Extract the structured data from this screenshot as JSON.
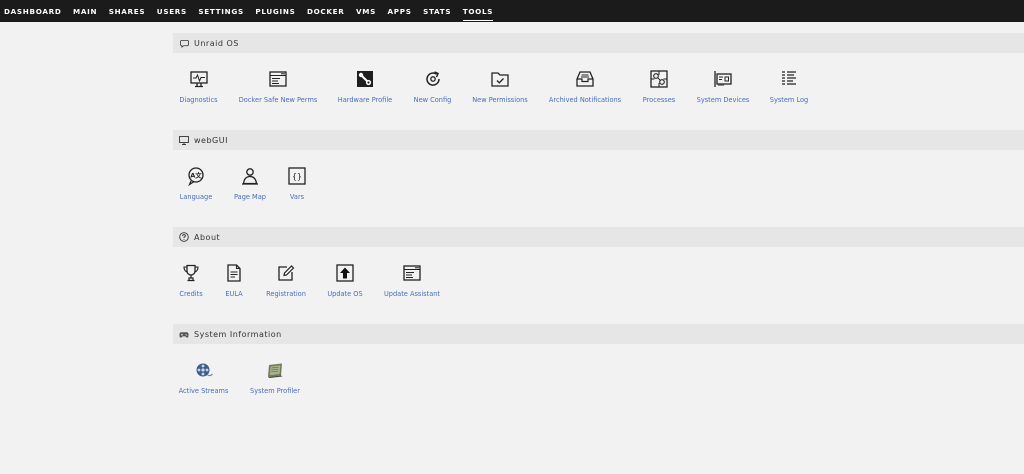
{
  "nav": {
    "items": [
      "DASHBOARD",
      "MAIN",
      "SHARES",
      "USERS",
      "SETTINGS",
      "PLUGINS",
      "DOCKER",
      "VMS",
      "APPS",
      "STATS",
      "TOOLS"
    ],
    "active": "TOOLS"
  },
  "sections": {
    "unraid_os": {
      "title": "Unraid OS",
      "icon": "chat-bubble-icon",
      "tools": [
        "Diagnostics",
        "Docker Safe New Perms",
        "Hardware Profile",
        "New Config",
        "New Permissions",
        "Archived Notifications",
        "Processes",
        "System Devices",
        "System Log"
      ]
    },
    "webgui": {
      "title": "webGUI",
      "icon": "monitor-icon",
      "tools": [
        "Language",
        "Page Map",
        "Vars"
      ]
    },
    "about": {
      "title": "About",
      "icon": "question-circle-icon",
      "tools": [
        "Credits",
        "EULA",
        "Registration",
        "Update OS",
        "Update Assistant"
      ]
    },
    "system_information": {
      "title": "System Information",
      "icon": "gamepad-icon",
      "tools": [
        "Active Streams",
        "System Profiler"
      ]
    }
  },
  "colors": {
    "nav_bg": "#1c1b1b",
    "page_bg": "#f2f2f2",
    "section_bg": "#e6e6e6",
    "link": "#486dba"
  }
}
